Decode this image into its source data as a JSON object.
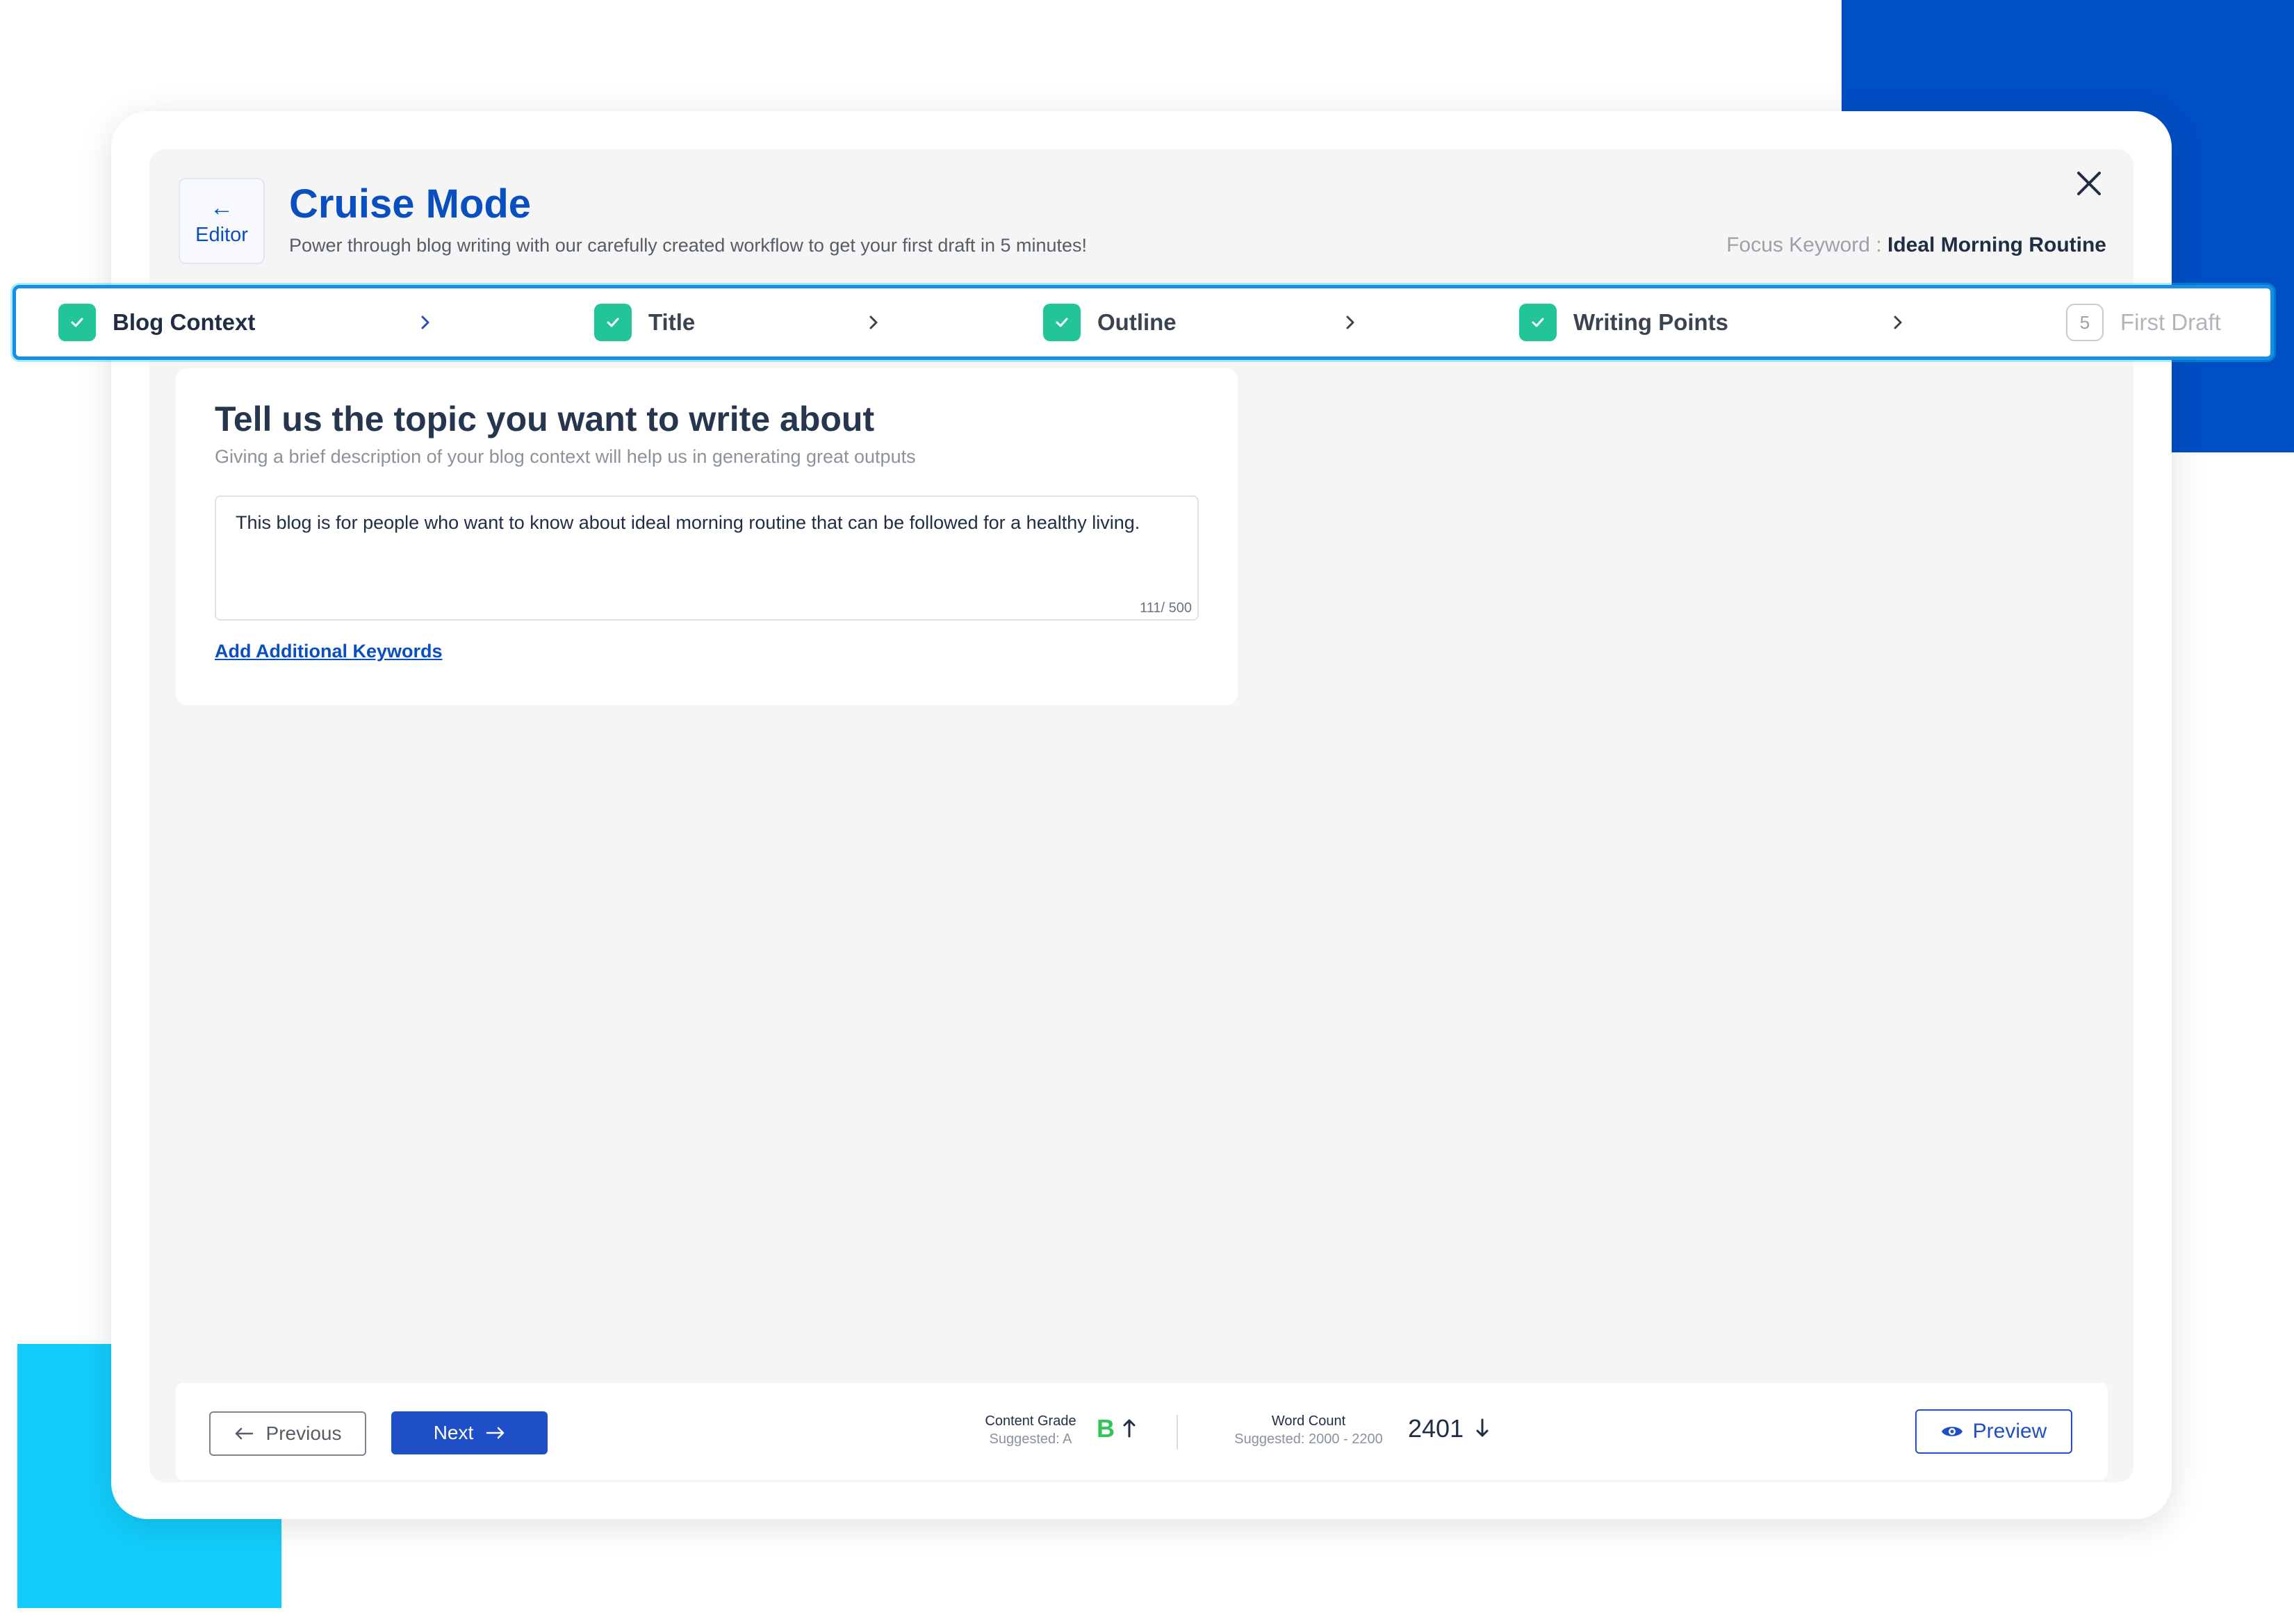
{
  "header": {
    "back_label": "Editor",
    "title": "Cruise Mode",
    "subtitle": "Power through blog writing with our carefully created workflow to get your first draft in 5 minutes!",
    "focus_keyword_label": "Focus Keyword : ",
    "focus_keyword_value": "Ideal Morning Routine"
  },
  "steps": [
    {
      "label": "Blog Context",
      "status": "complete",
      "active": true
    },
    {
      "label": "Title",
      "status": "complete"
    },
    {
      "label": "Outline",
      "status": "complete"
    },
    {
      "label": "Writing Points",
      "status": "complete"
    },
    {
      "label": "First Draft",
      "status": "pending",
      "number": "5"
    }
  ],
  "content": {
    "heading": "Tell us the topic you want to write about",
    "subheading": "Giving a brief description of your blog context will help us in generating great outputs",
    "textarea_value": "This blog is for people who want to know about ideal morning routine that can be followed for a healthy living.",
    "char_count": "111/ 500",
    "add_keywords_link": "Add Additional Keywords "
  },
  "footer": {
    "previous_label": "Previous",
    "next_label": "Next",
    "content_grade_label": "Content Grade",
    "content_grade_suggested": "Suggested: A",
    "content_grade_value": "B",
    "word_count_label": "Word Count",
    "word_count_suggested": "Suggested: 2000 - 2200",
    "word_count_value": "2401",
    "preview_label": "Preview"
  },
  "colors": {
    "brand_blue": "#0a4fbf",
    "button_blue": "#1e4fc7",
    "check_green": "#21c598",
    "grade_green": "#2ec55a",
    "deco_dark": "#004ec4",
    "deco_light": "#12cdfb"
  }
}
